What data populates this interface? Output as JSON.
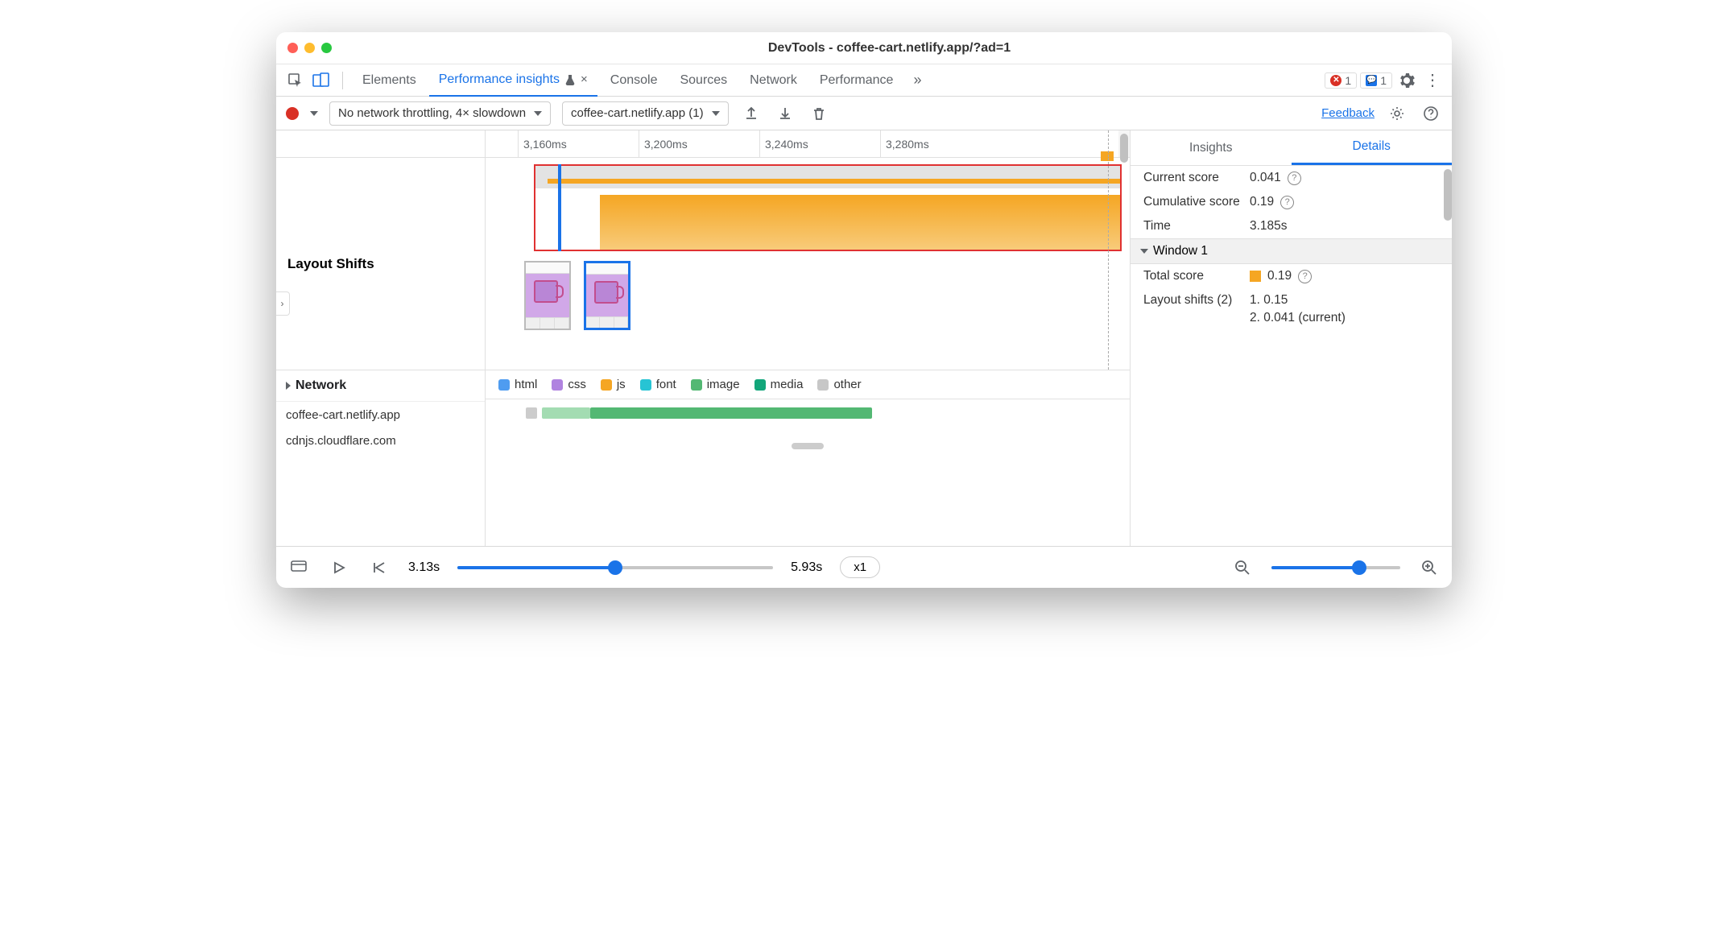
{
  "window": {
    "title": "DevTools - coffee-cart.netlify.app/?ad=1"
  },
  "tabs": {
    "elements": "Elements",
    "perf_insights": "Performance insights",
    "console": "Console",
    "sources": "Sources",
    "network": "Network",
    "performance": "Performance"
  },
  "badges": {
    "errors": "1",
    "issues": "1"
  },
  "toolbar": {
    "throttle": "No network throttling, 4× slowdown",
    "recording": "coffee-cart.netlify.app (1)",
    "feedback": "Feedback"
  },
  "ruler": {
    "t0": "3,160ms",
    "t1": "3,200ms",
    "t2": "3,240ms",
    "t3": "3,280ms"
  },
  "left": {
    "layout_shifts": "Layout Shifts",
    "network": "Network",
    "host1": "coffee-cart.netlify.app",
    "host2": "cdnjs.cloudflare.com"
  },
  "legend": {
    "html": "html",
    "css": "css",
    "js": "js",
    "font": "font",
    "image": "image",
    "media": "media",
    "other": "other"
  },
  "legend_colors": {
    "html": "#4f9cf0",
    "css": "#b083e0",
    "js": "#f5a623",
    "font": "#27c4d4",
    "image": "#53b873",
    "media": "#12a67a",
    "other": "#c7c7c7"
  },
  "right": {
    "tab_insights": "Insights",
    "tab_details": "Details",
    "current_score_k": "Current score",
    "current_score_v": "0.041",
    "cum_score_k": "Cumulative score",
    "cum_score_v": "0.19",
    "time_k": "Time",
    "time_v": "3.185s",
    "window_hdr": "Window 1",
    "total_score_k": "Total score",
    "total_score_v": "0.19",
    "ls_k": "Layout shifts (2)",
    "ls_1": "1. 0.15",
    "ls_2": "2. 0.041 (current)"
  },
  "footer": {
    "start": "3.13s",
    "end": "5.93s",
    "speed": "x1"
  }
}
